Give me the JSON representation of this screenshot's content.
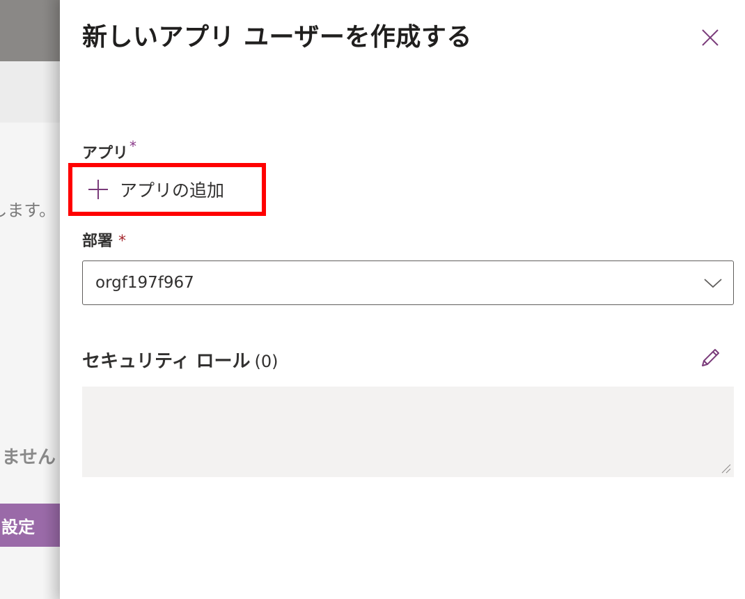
{
  "background": {
    "partial_text_1": "します。",
    "partial_text_2": "ません",
    "partial_button_label": "設定"
  },
  "panel": {
    "title": "新しいアプリ ユーザーを作成する",
    "close_icon": "close-icon",
    "app_field": {
      "label": "アプリ",
      "required_mark": "*",
      "add_button_label": "アプリの追加",
      "add_icon": "plus-icon"
    },
    "department_field": {
      "label": "部署",
      "required_mark": "*",
      "selected_value": "orgf197f967",
      "dropdown_icon": "chevron-down-icon"
    },
    "security_roles": {
      "title": "セキュリティ ロール",
      "count": "(0)",
      "edit_icon": "pencil-icon",
      "value": ""
    }
  },
  "colors": {
    "accent_purple": "#7a3b7a",
    "highlight_red": "#ff0000",
    "required_red": "#a4262c",
    "roles_box_bg": "#f3f2f1"
  }
}
